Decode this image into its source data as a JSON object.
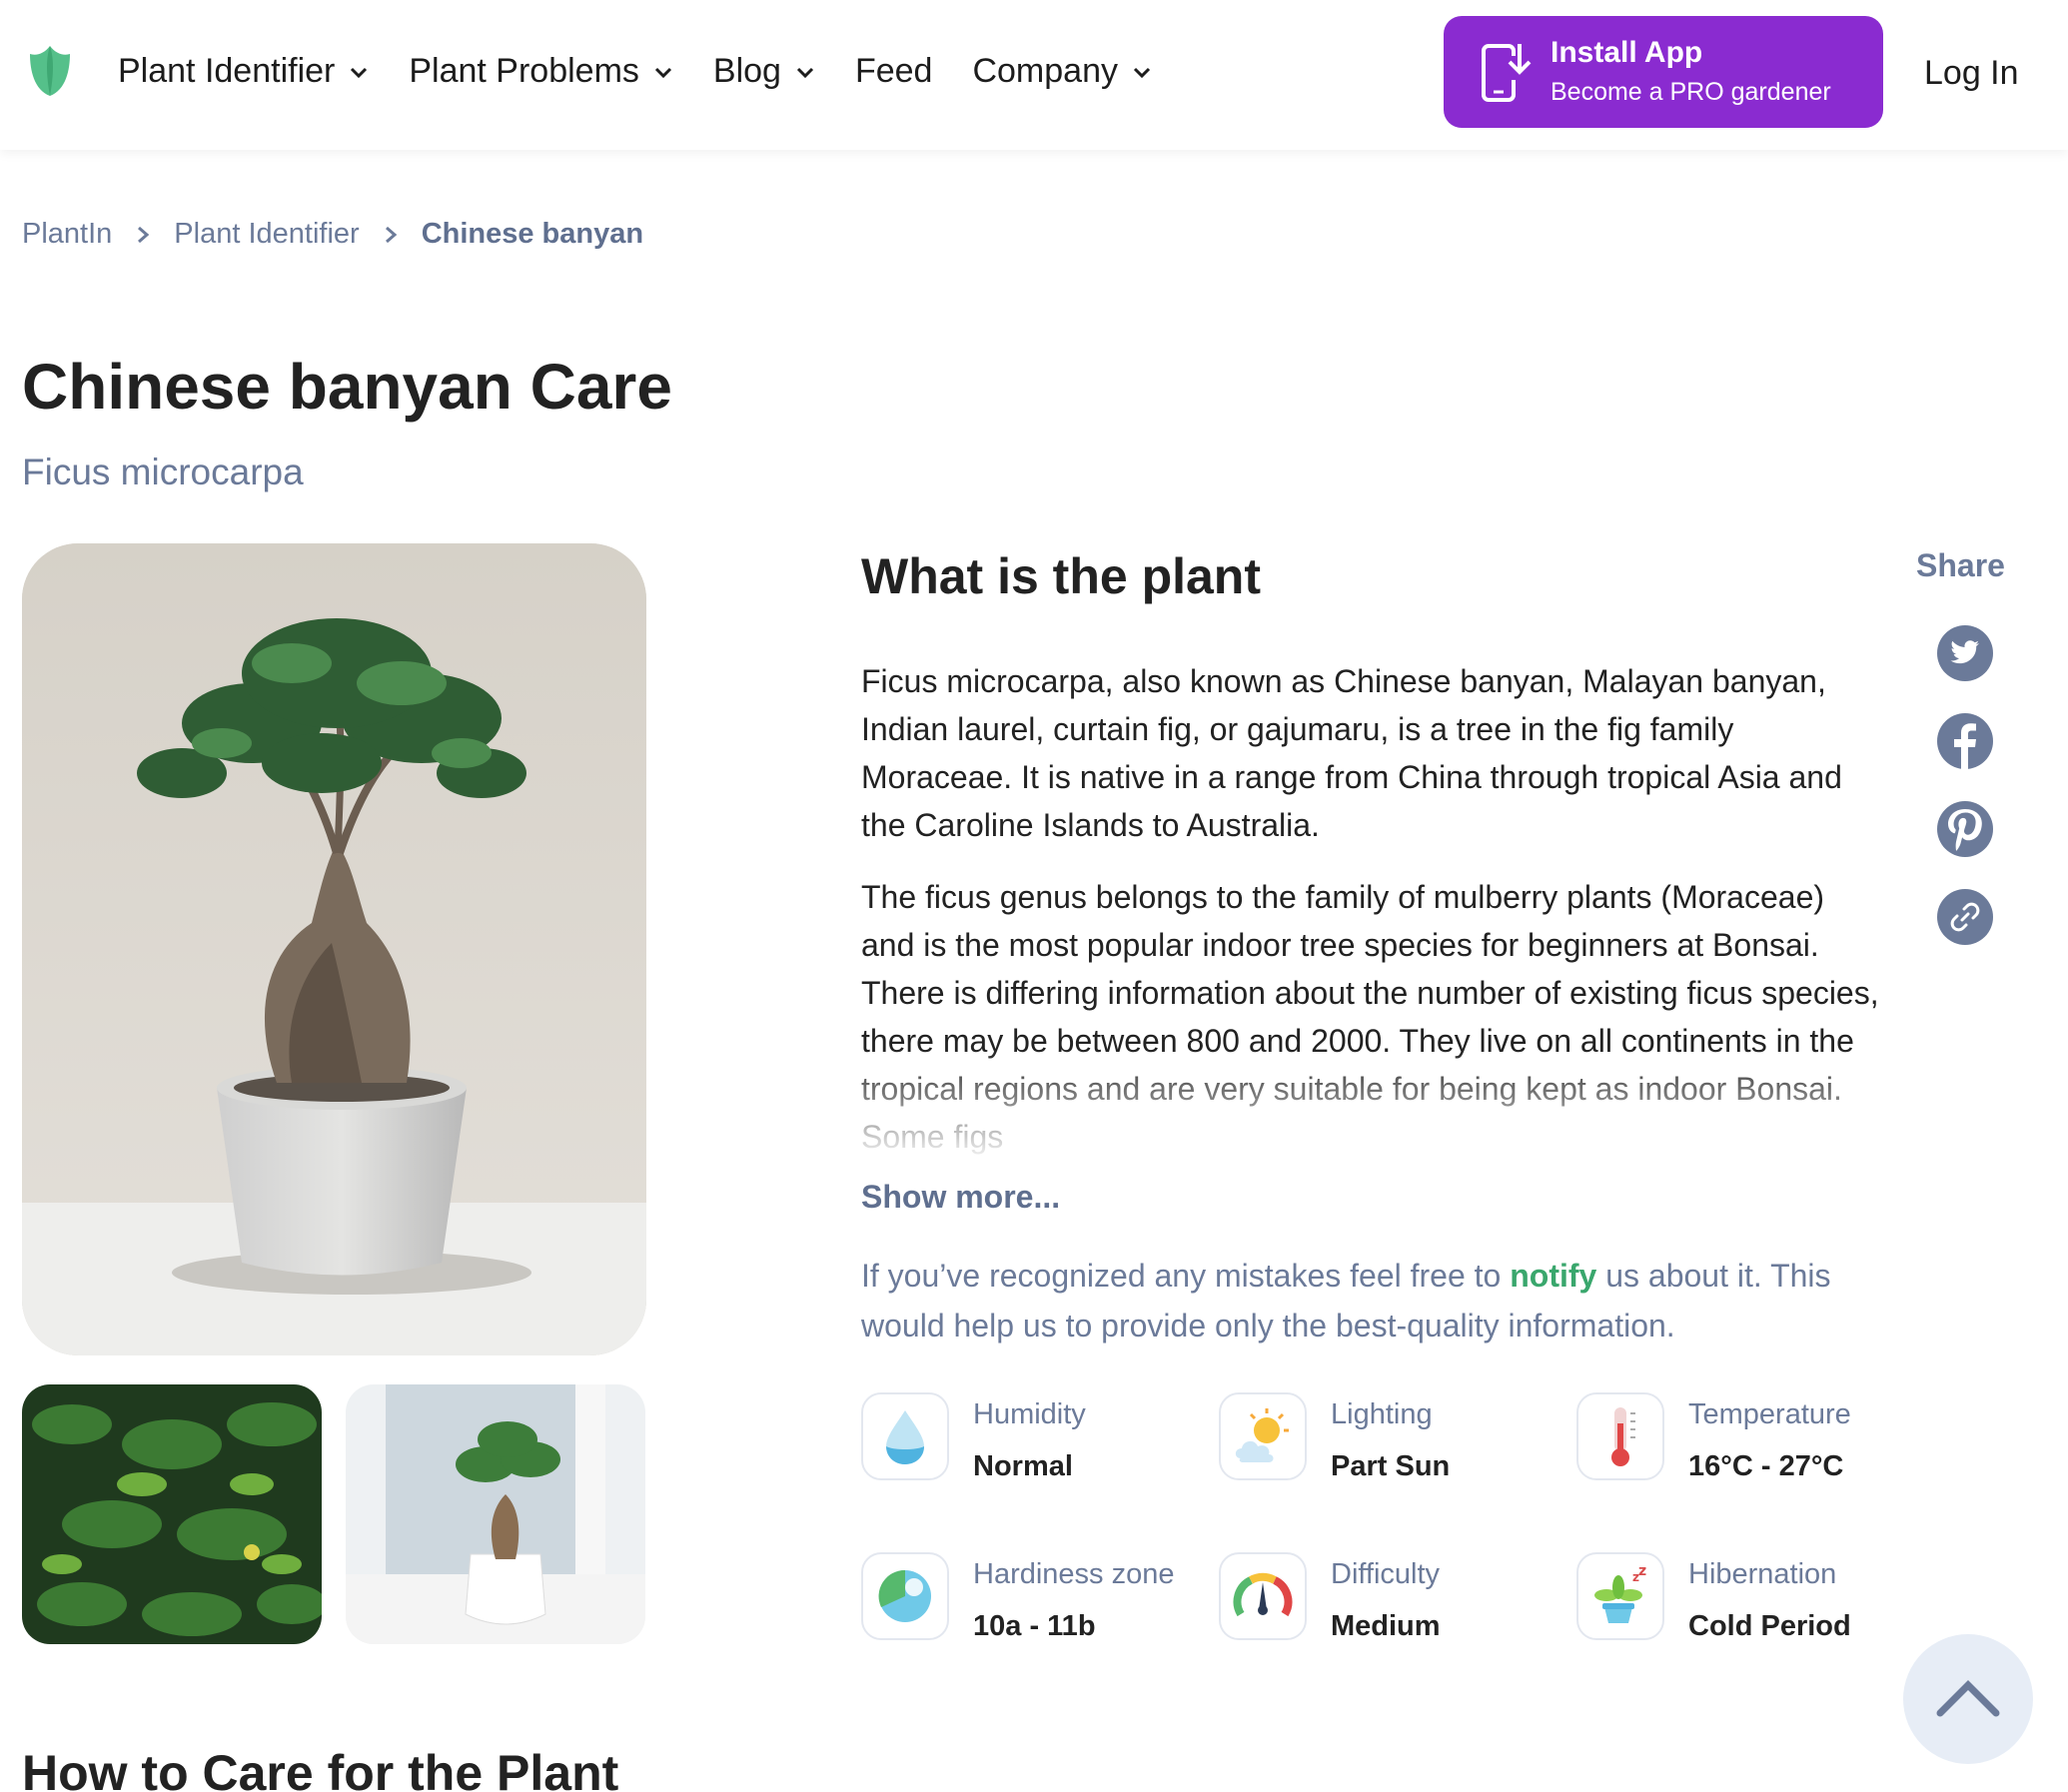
{
  "header": {
    "nav": [
      {
        "label": "Plant Identifier",
        "has_dropdown": true
      },
      {
        "label": "Plant Problems",
        "has_dropdown": true
      },
      {
        "label": "Blog",
        "has_dropdown": true
      },
      {
        "label": "Feed",
        "has_dropdown": false
      },
      {
        "label": "Company",
        "has_dropdown": true
      }
    ],
    "install": {
      "title": "Install App",
      "subtitle": "Become a PRO gardener"
    },
    "login": "Log In"
  },
  "breadcrumb": [
    "PlantIn",
    "Plant Identifier",
    "Chinese banyan"
  ],
  "plant": {
    "title": "Chinese banyan Care",
    "latin": "Ficus microcarpa"
  },
  "about": {
    "title": "What is the plant",
    "paragraph1": "Ficus microcarpa, also known as Chinese banyan, Malayan banyan, Indian laurel, curtain fig, or gajumaru, is a tree in the fig family Moraceae. It is native in a range from China through tropical Asia and the Caroline Islands to Australia.",
    "paragraph2": "The ficus genus belongs to the family of mulberry plants (Moraceae) and is the most popular indoor tree species for beginners at Bonsai. There is differing information about the number of existing ficus species, there may be between 800 and 2000. They live on all continents in the tropical regions and are very suitable for being kept as indoor Bonsai. Some figs",
    "show_more": "Show more...",
    "notice_before": "If you’ve recognized any mistakes feel free to ",
    "notice_link": "notify",
    "notice_after": " us about it. This would help us to provide only the best-quality information."
  },
  "share": {
    "title": "Share",
    "icons": [
      "twitter-icon",
      "facebook-icon",
      "pinterest-icon",
      "link-icon"
    ]
  },
  "care": [
    {
      "label": "Humidity",
      "value": "Normal",
      "icon": "humidity-icon"
    },
    {
      "label": "Lighting",
      "value": "Part Sun",
      "icon": "lighting-icon"
    },
    {
      "label": "Temperature",
      "value": "16°C - 27°C",
      "icon": "temperature-icon"
    },
    {
      "label": "Hardiness zone",
      "value": "10a - 11b",
      "icon": "hardiness-zone-icon"
    },
    {
      "label": "Difficulty",
      "value": "Medium",
      "icon": "difficulty-icon"
    },
    {
      "label": "Hibernation",
      "value": "Cold Period",
      "icon": "hibernation-icon"
    }
  ],
  "how_to_care_title": "How to Care for the Plant",
  "colors": {
    "accent": "#8A2BD0",
    "brand_green": "#3aa76d",
    "muted": "#6b7a99"
  }
}
